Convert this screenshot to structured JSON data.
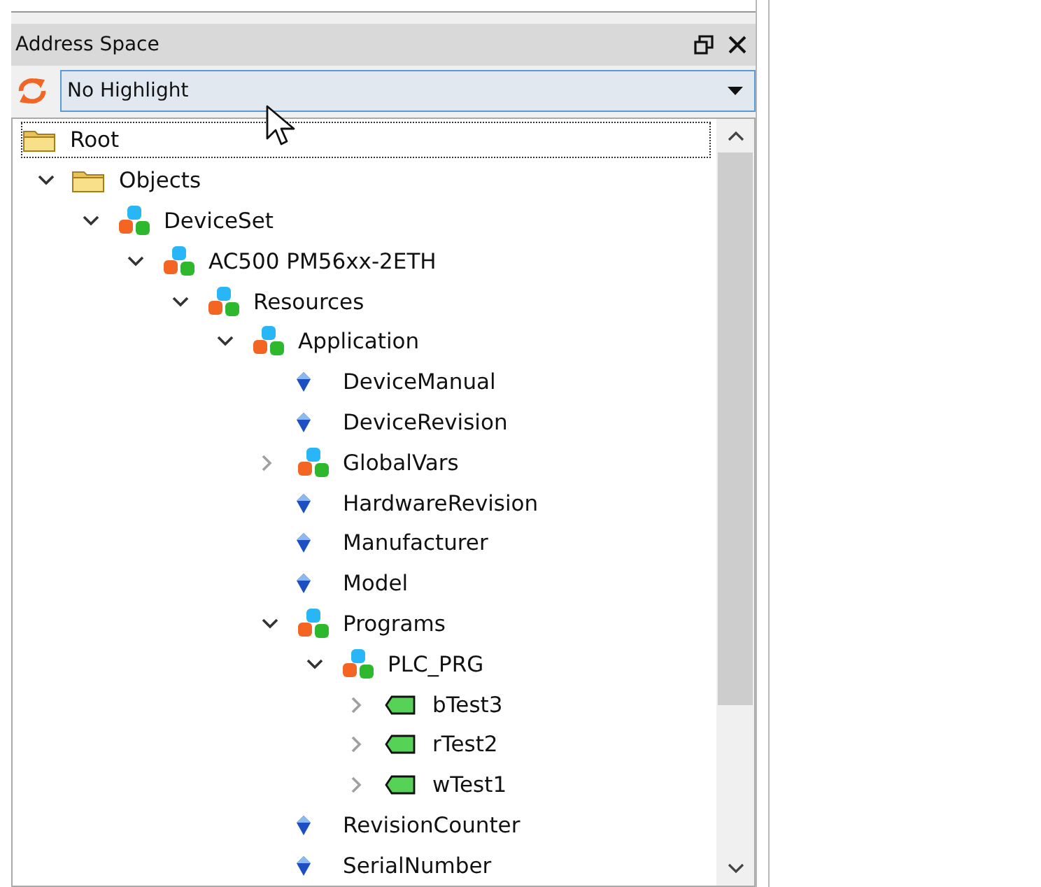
{
  "panel": {
    "title": "Address Space",
    "highlight": {
      "value": "No Highlight"
    },
    "tree": [
      {
        "label": "Root",
        "kind": "folder",
        "selected": true,
        "children": [
          {
            "label": "Objects",
            "kind": "folder",
            "selected": false,
            "expanded": true,
            "children": [
              {
                "label": "DeviceSet",
                "kind": "object",
                "selected": false,
                "expanded": true,
                "children": [
                  {
                    "label": "AC500 PM56xx-2ETH",
                    "kind": "object",
                    "selected": false,
                    "expanded": true,
                    "children": [
                      {
                        "label": "Resources",
                        "kind": "object",
                        "selected": false,
                        "expanded": true,
                        "children": [
                          {
                            "label": "Application",
                            "kind": "object",
                            "selected": false,
                            "expanded": true,
                            "children": [
                              {
                                "label": "DeviceManual",
                                "kind": "property",
                                "selected": false
                              },
                              {
                                "label": "DeviceRevision",
                                "kind": "property",
                                "selected": false
                              },
                              {
                                "label": "GlobalVars",
                                "kind": "object",
                                "selected": false,
                                "expanded": false
                              },
                              {
                                "label": "HardwareRevision",
                                "kind": "property",
                                "selected": false
                              },
                              {
                                "label": "Manufacturer",
                                "kind": "property",
                                "selected": false
                              },
                              {
                                "label": "Model",
                                "kind": "property",
                                "selected": false
                              },
                              {
                                "label": "Programs",
                                "kind": "object",
                                "selected": false,
                                "expanded": true,
                                "children": [
                                  {
                                    "label": "PLC_PRG",
                                    "kind": "object",
                                    "selected": false,
                                    "expanded": true,
                                    "children": [
                                      {
                                        "label": "bTest3",
                                        "kind": "variable",
                                        "selected": false,
                                        "expanded": false
                                      },
                                      {
                                        "label": "rTest2",
                                        "kind": "variable",
                                        "selected": false,
                                        "expanded": false
                                      },
                                      {
                                        "label": "wTest1",
                                        "kind": "variable",
                                        "selected": false,
                                        "expanded": false
                                      }
                                    ]
                                  }
                                ]
                              },
                              {
                                "label": "RevisionCounter",
                                "kind": "property",
                                "selected": false
                              },
                              {
                                "label": "SerialNumber",
                                "kind": "property",
                                "selected": false
                              }
                            ]
                          }
                        ]
                      }
                    ]
                  }
                ]
              }
            ]
          }
        ]
      }
    ]
  }
}
